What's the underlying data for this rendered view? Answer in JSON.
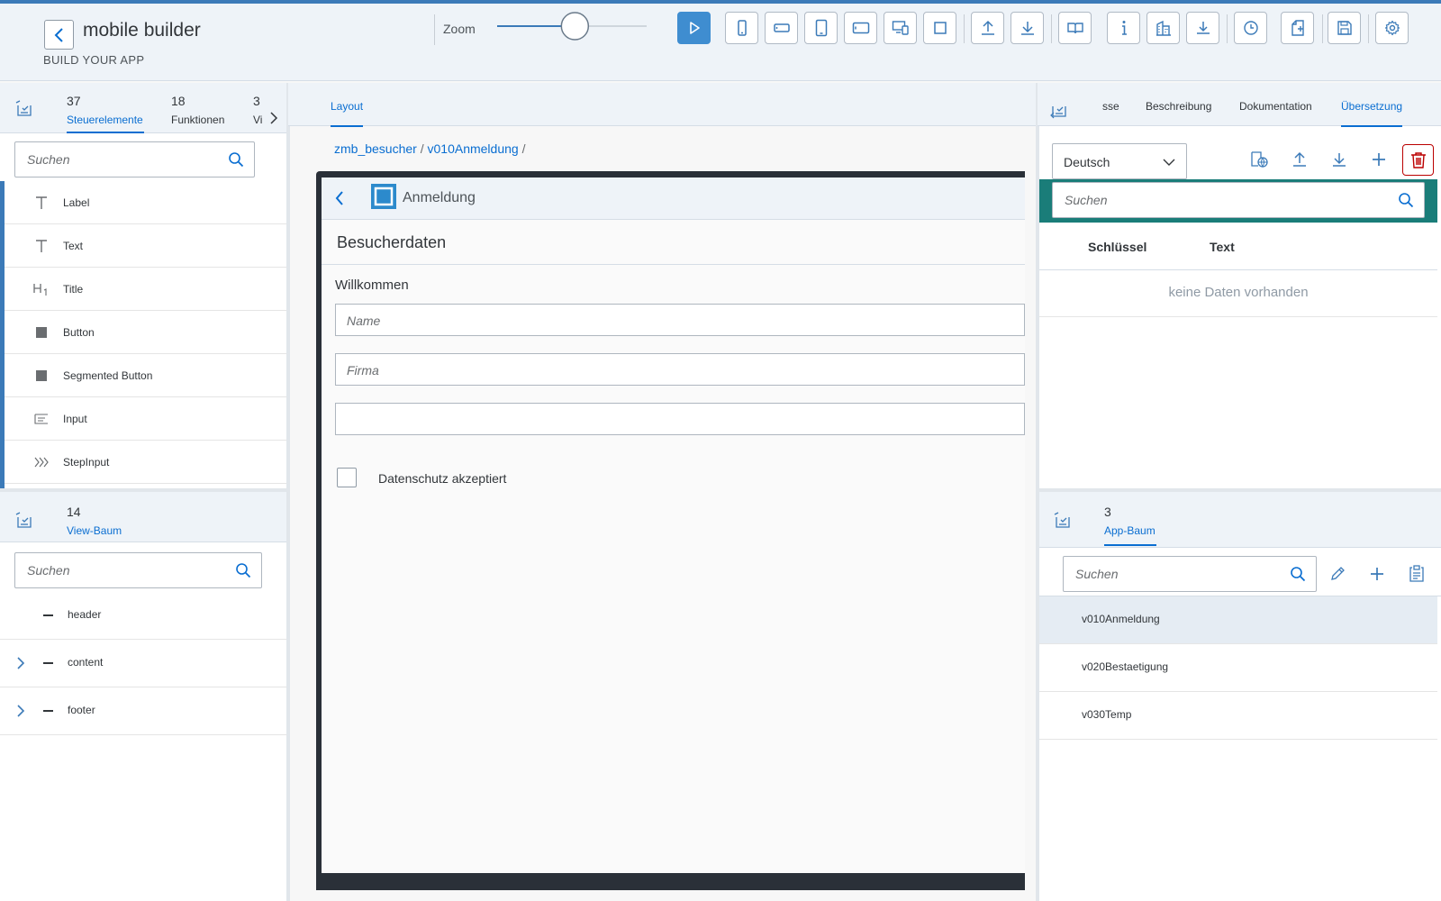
{
  "shell": {
    "title": "mobile builder",
    "subtitle": "BUILD YOUR APP",
    "zoom_label": "Zoom",
    "zoom_level": 0.52,
    "toolbar_icons": [
      "play-icon",
      "phone-portrait-icon",
      "phone-landscape-icon",
      "tablet-portrait-icon",
      "tablet-landscape-icon",
      "desktop-tablet-icon",
      "square-frame-icon",
      "upload-icon",
      "download-icon",
      "open-book-icon",
      "info-icon",
      "buildings-icon",
      "download-tray-icon",
      "history-clock-icon",
      "add-document-icon",
      "save-icon",
      "settings-icon"
    ]
  },
  "left_top": {
    "tabs": [
      {
        "count": "37",
        "label": "Steuerelemente",
        "active": true
      },
      {
        "count": "18",
        "label": "Funktionen",
        "active": false
      },
      {
        "count": "3",
        "label": "Vi",
        "active": false
      }
    ],
    "search_placeholder": "Suchen",
    "controls": [
      {
        "label": "Label",
        "icon": "text-t-icon"
      },
      {
        "label": "Text",
        "icon": "text-t-icon"
      },
      {
        "label": "Title",
        "icon": "heading-icon"
      },
      {
        "label": "Button",
        "icon": "square-icon"
      },
      {
        "label": "Segmented Button",
        "icon": "square-icon"
      },
      {
        "label": "Input",
        "icon": "input-lines-icon"
      },
      {
        "label": "StepInput",
        "icon": "step-chevrons-icon"
      }
    ]
  },
  "left_bottom": {
    "tab": {
      "count": "14",
      "label": "View-Baum"
    },
    "search_placeholder": "Suchen",
    "tree": [
      {
        "label": "header",
        "expandable": false
      },
      {
        "label": "content",
        "expandable": true
      },
      {
        "label": "footer",
        "expandable": true
      }
    ]
  },
  "center": {
    "tab_label": "Layout",
    "breadcrumb": [
      "zmb_besucher",
      "v010Anmeldung"
    ],
    "breadcrumb_sep": "/",
    "mobile": {
      "header_title": "Anmeldung",
      "section_title": "Besucherdaten",
      "welcome": "Willkommen",
      "inputs": [
        {
          "placeholder": "Name"
        },
        {
          "placeholder": "Firma"
        },
        {
          "placeholder": ""
        }
      ],
      "checkbox_label": "Datenschutz akzeptiert",
      "checkbox_checked": false
    }
  },
  "right_top": {
    "tabs": [
      {
        "label": "sse",
        "active": false
      },
      {
        "label": "Beschreibung",
        "active": false
      },
      {
        "label": "Dokumentation",
        "active": false
      },
      {
        "label": "Übersetzung",
        "active": true
      }
    ],
    "language": "Deutsch",
    "search_placeholder": "Suchen",
    "columns": [
      "Schlüssel",
      "Text"
    ],
    "no_data": "keine Daten vorhanden"
  },
  "right_bottom": {
    "tab": {
      "count": "3",
      "label": "App-Baum"
    },
    "search_placeholder": "Suchen",
    "views": [
      {
        "label": "v010Anmeldung",
        "selected": true
      },
      {
        "label": "v020Bestaetigung",
        "selected": false
      },
      {
        "label": "v030Temp",
        "selected": false
      }
    ]
  },
  "colors": {
    "accent": "#0a6ed1",
    "primary_button": "#3f8dd0",
    "header_bg": "#eef3f8",
    "teal_bar": "#1a7d79",
    "delete": "#bb0000"
  }
}
